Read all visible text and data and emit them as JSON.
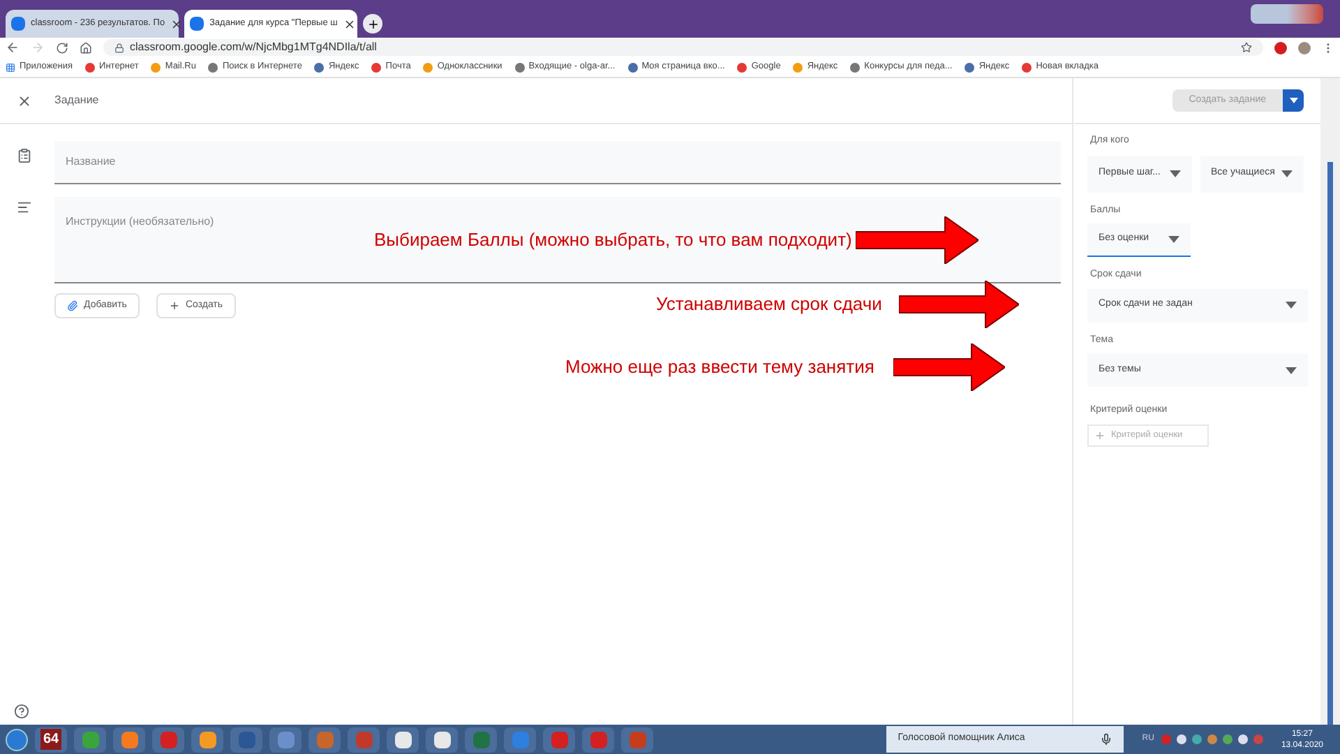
{
  "browser": {
    "tabs": [
      {
        "title": "classroom - 236 результатов. По",
        "selected": false
      },
      {
        "title": "Задание для курса \"Первые ш",
        "selected": true
      }
    ],
    "url": "classroom.google.com/w/NjcMbg1MTg4NDIla/t/all",
    "bookmarks": [
      "Приложения",
      "Интернет",
      "Mail.Ru",
      "Поиск в Интернете",
      "Яндекс",
      "Почта",
      "Одноклассники",
      "Входящие - olga-ar...",
      "Моя страница вко...",
      "Google",
      "Яндекс",
      "Конкурсы для педа...",
      "Яндекс",
      "Новая вкладка"
    ]
  },
  "header": {
    "title": "Задание",
    "submit": {
      "label": "Создать задание",
      "disabled": true
    }
  },
  "form": {
    "title_placeholder": "Название",
    "instructions_placeholder": "Инструкции (необязательно)",
    "buttons": [
      "Добавить",
      "Создать"
    ]
  },
  "annotations": [
    "Выбираем Баллы (можно выбрать, то что вам подходит)",
    "Устанавливаем срок сдачи",
    "Можно еще раз ввести тему занятия"
  ],
  "settings": {
    "for_whom": {
      "label": "Для кого",
      "selects": [
        {
          "value": "Первые шаг...",
          "focused": false
        },
        {
          "value": "Все учащиеся",
          "focused": false
        }
      ]
    },
    "fields": [
      {
        "label": "Баллы",
        "value": "Без оценки",
        "focused": true,
        "wide": false
      },
      {
        "label": "Срок сдачи",
        "value": "Срок сдачи не задан",
        "focused": false,
        "wide": true
      },
      {
        "label": "Тема",
        "value": "Без темы",
        "focused": false,
        "wide": true
      }
    ],
    "rubric": {
      "label": "Критерий оценки",
      "button": "Критерий оценки"
    }
  },
  "taskbar": {
    "badge": "64",
    "assistant": "Голосовой помощник Алиса",
    "language": "RU",
    "time": "15:27",
    "date": "13.04.2020"
  }
}
